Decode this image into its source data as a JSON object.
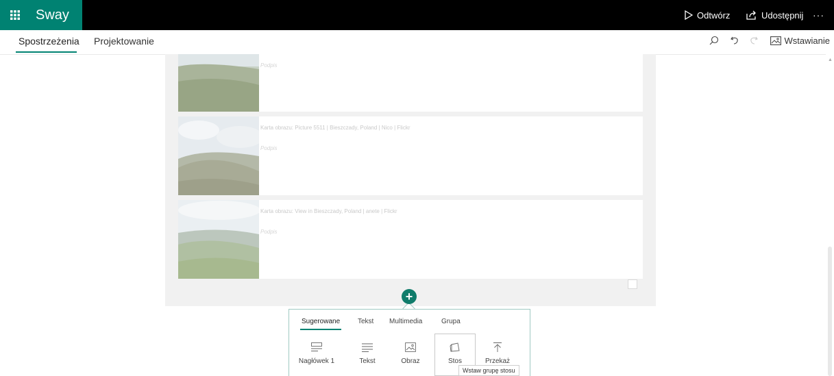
{
  "app": {
    "brand": "Sway",
    "play_label": "Odtwórz",
    "share_label": "Udostępnij",
    "more_label": "···"
  },
  "tabs": {
    "insights": "Spostrzeżenia",
    "design": "Projektowanie"
  },
  "toolbar": {
    "insert_label": "Wstawianie"
  },
  "cards": [
    {
      "title": "",
      "caption": "Podpis"
    },
    {
      "title": "Karta obrazu: Picture 5511 | Bieszczady, Poland | Nico | Flickr",
      "caption": "Podpis"
    },
    {
      "title": "Karta obrazu: View in Bieszczady, Poland | anete | Flickr",
      "caption": "Podpis"
    }
  ],
  "insert_panel": {
    "tabs": [
      "Sugerowane",
      "Tekst",
      "Multimedia",
      "Grupa"
    ],
    "items": [
      {
        "label": "Nagłówek 1",
        "icon": "heading-icon"
      },
      {
        "label": "Tekst",
        "icon": "text-icon"
      },
      {
        "label": "Obraz",
        "icon": "image-icon"
      },
      {
        "label": "Stos",
        "icon": "stack-icon"
      },
      {
        "label": "Przekaż",
        "icon": "upload-icon"
      }
    ],
    "tooltip": "Wstaw grupę stosu"
  },
  "colors": {
    "accent": "#008272",
    "topbar": "#000000"
  }
}
